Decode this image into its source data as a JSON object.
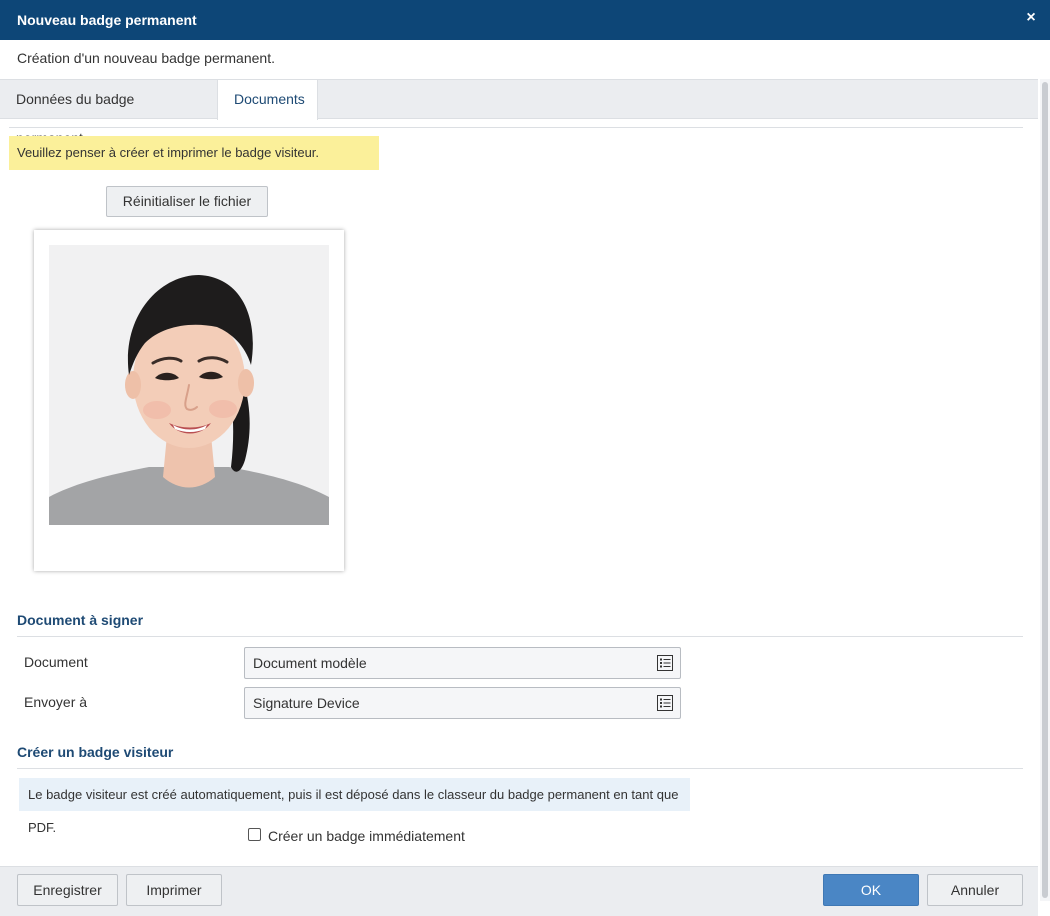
{
  "dialog": {
    "title": "Nouveau badge permanent",
    "close_glyph": "×",
    "subtitle": "Création d'un nouveau badge permanent."
  },
  "tabs": [
    {
      "label": "Données du badge permanent",
      "active": false
    },
    {
      "label": "Documents",
      "active": true
    }
  ],
  "warning": {
    "text": "Veuillez penser à créer et imprimer le badge visiteur."
  },
  "photo": {
    "reset_label": "Réinitialiser le fichier"
  },
  "sign_section": {
    "title": "Document à signer",
    "fields": [
      {
        "label": "Document",
        "value": "Document modèle",
        "icon": "list-icon"
      },
      {
        "label": "Envoyer à",
        "value": "Signature Device",
        "icon": "list-icon"
      }
    ]
  },
  "visitor_section": {
    "title": "Créer un badge visiteur",
    "info": "Le badge visiteur est créé automatiquement, puis il est déposé dans le classeur du badge permanent en tant que PDF.",
    "checkbox_label": "Créer un badge immédiatement",
    "checkbox_checked": false
  },
  "footer": {
    "save": "Enregistrer",
    "print": "Imprimer",
    "ok": "OK",
    "cancel": "Annuler"
  },
  "colors": {
    "titlebar": "#0d4677",
    "accent_text": "#1e4a74",
    "warning_bg": "#fbf09a",
    "info_bg": "#e8f1f9",
    "ok_button": "#4a86c5"
  }
}
